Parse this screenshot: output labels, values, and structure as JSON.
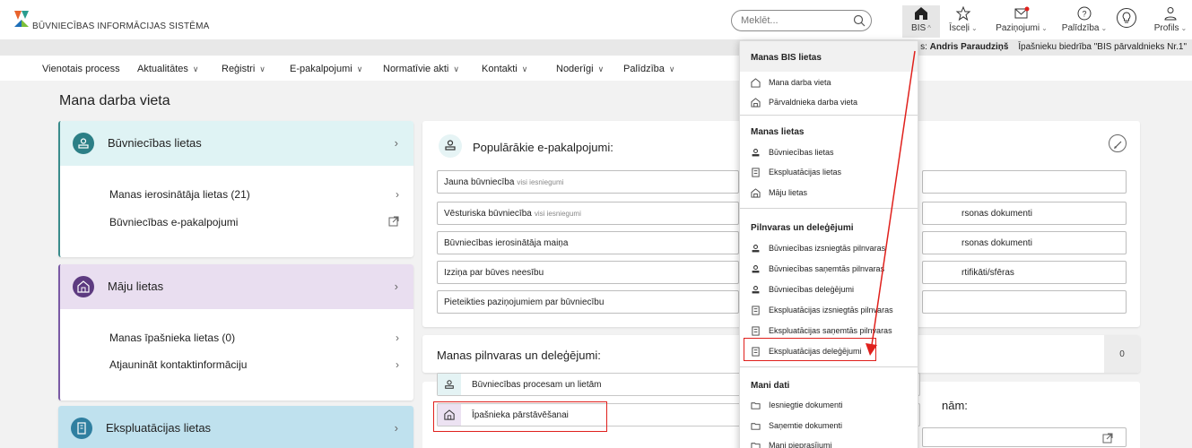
{
  "header": {
    "system_title": "BŪVNIECĪBAS INFORMĀCIJAS SISTĒMA",
    "search_placeholder": "Meklēt...",
    "tools": {
      "bis": "BIS",
      "shortcuts": "Īsceļi",
      "notifications": "Paziņojumi",
      "help": "Palīdzība",
      "profile": "Profils"
    },
    "user": {
      "partial_label": "s:",
      "name": "Andris Paraudziņš",
      "org": "Īpašnieku biedrība \"BIS pārvaldnieks Nr.1\""
    }
  },
  "nav": [
    "Vienotais process",
    "Aktualitātes",
    "Reģistri",
    "E-pakalpojumi",
    "Normatīvie akti",
    "Kontakti",
    "Noderīgi",
    "Palīdzība"
  ],
  "main": {
    "page_title": "Mana darba vieta",
    "cards": {
      "buvniecibas": {
        "title": "Būvniecības lietas",
        "rows": [
          "Manas ierosinātāja lietas (21)",
          "Būvniecības e-pakalpojumi"
        ]
      },
      "maju": {
        "title": "Māju lietas",
        "rows": [
          "Manas īpašnieka lietas (0)",
          "Atjaunināt kontaktinformāciju"
        ]
      },
      "ekspluatacijas": {
        "title": "Ekspluatācijas lietas"
      }
    },
    "popular": {
      "title": "Populārākie e-pakalpojumi:",
      "items": [
        {
          "label": "Jauna būvniecība",
          "sub": "visi iesniegumi"
        },
        {
          "label": "Vēsturiska būvniecība",
          "sub": "visi iesniegumi"
        },
        {
          "label": "Būvniecības ierosinātāja maiņa",
          "sub": ""
        },
        {
          "label": "Izziņa par būves neesību",
          "sub": ""
        },
        {
          "label": "Pieteikties paziņojumiem par būvniecību",
          "sub": ""
        }
      ],
      "right_items": [
        "rsonas dokumenti",
        "rsonas dokumenti",
        "rtifikāti/sfēras"
      ]
    },
    "pilnvaras": {
      "title": "Manas pilnvaras un deleģējumi:",
      "count": "0",
      "options": [
        "Būvniecības procesam un lietām",
        "Īpašnieka pārstāvēšanai"
      ]
    },
    "partial_title": "nām:"
  },
  "dropdown": {
    "title": "Manas BIS lietas",
    "top_items": [
      "Mana darba vieta",
      "Pārvaldnieka darba vieta"
    ],
    "sections": [
      {
        "title": "Manas lietas",
        "items": [
          "Būvniecības lietas",
          "Ekspluatācijas lietas",
          "Māju lietas"
        ]
      },
      {
        "title": "Pilnvaras un deleģējumi",
        "items": [
          "Būvniecības izsniegtās pilnvaras",
          "Būvniecības saņemtās pilnvaras",
          "Būvniecības deleģējumi",
          "Ekspluatācijas izsniegtās pilnvaras",
          "Ekspluatācijas saņemtās pilnvaras",
          "Ekspluatācijas deleģējumi"
        ]
      },
      {
        "title": "Mani dati",
        "items": [
          "Iesniegtie dokumenti",
          "Saņemtie dokumenti",
          "Mani pieprasījumi"
        ]
      }
    ]
  },
  "colors": {
    "accent_red": "#e0201c",
    "teal": "#2c7f86",
    "purple": "#5d3a80",
    "blue": "#2f7fa0"
  },
  "icons": [
    "logo-icon",
    "search-icon",
    "home-icon",
    "star-icon",
    "mail-icon",
    "help-icon",
    "lightbulb-icon",
    "user-icon",
    "chevron-down-icon",
    "chevron-right-icon",
    "external-link-icon",
    "pencil-icon",
    "house-icon",
    "building-icon",
    "folder-icon"
  ]
}
